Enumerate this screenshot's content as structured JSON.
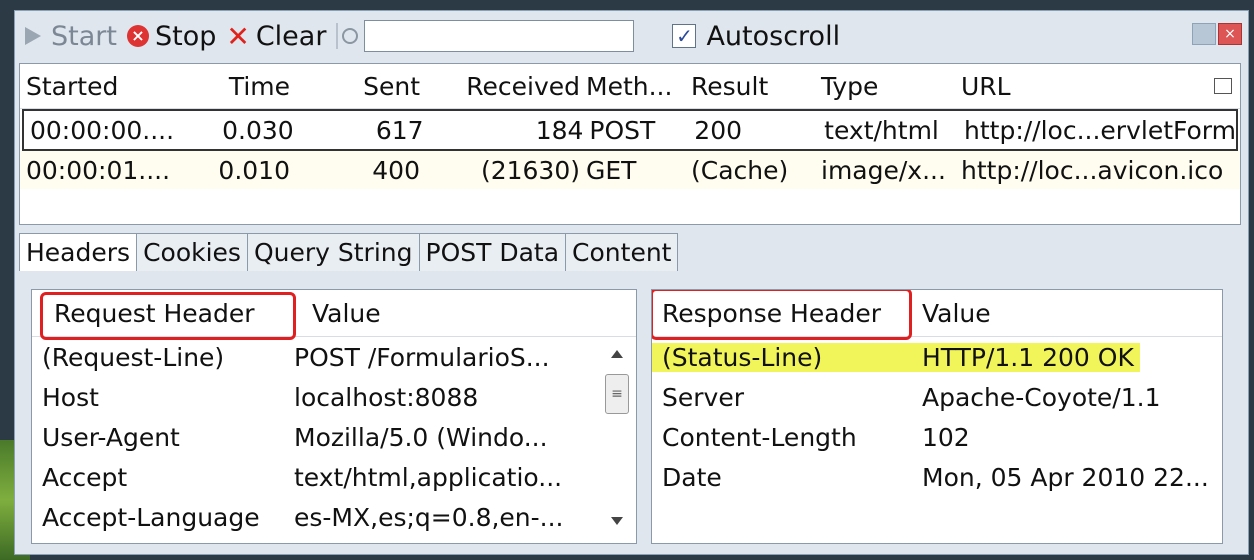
{
  "toolbar": {
    "start_label": "Start",
    "stop_label": "Stop",
    "clear_label": "Clear",
    "search_value": "",
    "autoscroll_label": "Autoscroll",
    "autoscroll_checked": "✓"
  },
  "list": {
    "columns": {
      "started": "Started",
      "time": "Time",
      "sent": "Sent",
      "received": "Received",
      "method": "Meth...",
      "result": "Result",
      "type": "Type",
      "url": "URL"
    },
    "rows": [
      {
        "started": "00:00:00....",
        "time": "0.030",
        "sent": "617",
        "received": "184",
        "method": "POST",
        "result": "200",
        "type": "text/html",
        "url": "http://loc...ervletForm"
      },
      {
        "started": "00:00:01....",
        "time": "0.010",
        "sent": "400",
        "received": "(21630)",
        "method": "GET",
        "result": "(Cache)",
        "type": "image/x...",
        "url": "http://loc...avicon.ico"
      }
    ]
  },
  "tabs": [
    "Headers",
    "Cookies",
    "Query String",
    "POST Data",
    "Content"
  ],
  "request_panel": {
    "header_col": "Request Header",
    "value_col": "Value",
    "rows": [
      {
        "name": "(Request-Line)",
        "value": "POST /FormularioS..."
      },
      {
        "name": "Host",
        "value": "localhost:8088"
      },
      {
        "name": "User-Agent",
        "value": "Mozilla/5.0 (Windo..."
      },
      {
        "name": "Accept",
        "value": "text/html,applicatio..."
      },
      {
        "name": "Accept-Language",
        "value": "es-MX,es;q=0.8,en-..."
      }
    ]
  },
  "response_panel": {
    "header_col": "Response Header",
    "value_col": "Value",
    "rows": [
      {
        "name": "(Status-Line)",
        "value": "HTTP/1.1 200 OK"
      },
      {
        "name": "Server",
        "value": "Apache-Coyote/1.1"
      },
      {
        "name": "Content-Length",
        "value": "102"
      },
      {
        "name": "Date",
        "value": "Mon, 05 Apr 2010 22..."
      }
    ]
  },
  "colors": {
    "highlight": "#f2f55a",
    "callout": "#e02020"
  }
}
